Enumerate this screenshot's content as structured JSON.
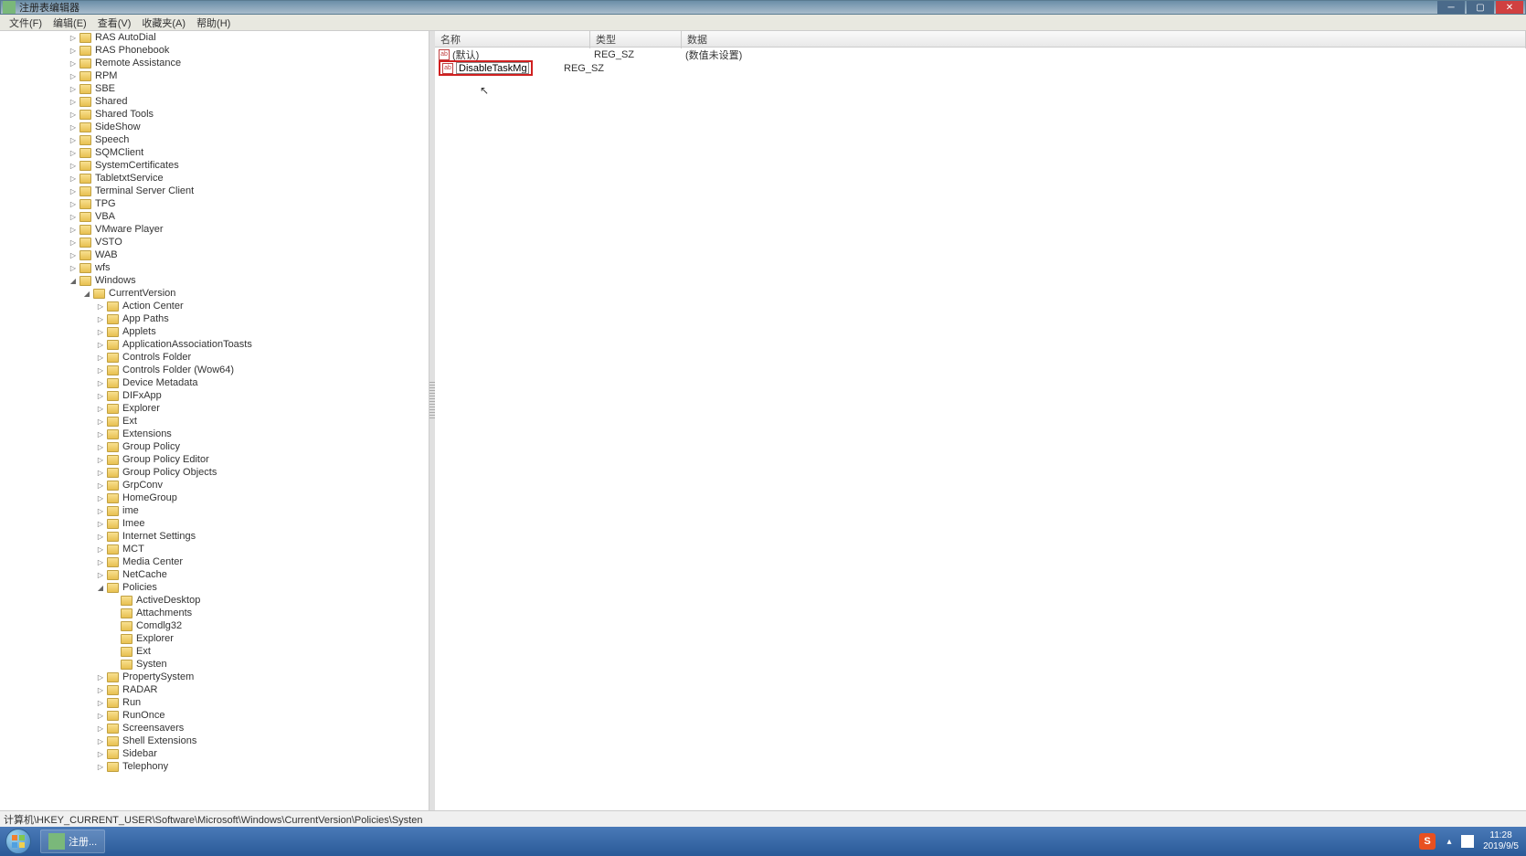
{
  "window": {
    "title": "注册表编辑器"
  },
  "menu": {
    "file": "文件(F)",
    "edit": "编辑(E)",
    "view": "查看(V)",
    "favorites": "收藏夹(A)",
    "help": "帮助(H)"
  },
  "tree": {
    "level1": [
      "RAS AutoDial",
      "RAS Phonebook",
      "Remote Assistance",
      "RPM",
      "SBE",
      "Shared",
      "Shared Tools",
      "SideShow",
      "Speech",
      "SQMClient",
      "SystemCertificates",
      "TabletxtService",
      "Terminal Server Client",
      "TPG",
      "VBA",
      "VMware Player",
      "VSTO",
      "WAB",
      "wfs"
    ],
    "windows": "Windows",
    "currentVersion": "CurrentVersion",
    "cv_children": [
      "Action Center",
      "App Paths",
      "Applets",
      "ApplicationAssociationToasts",
      "Controls Folder",
      "Controls Folder (Wow64)",
      "Device Metadata",
      "DIFxApp",
      "Explorer",
      "Ext",
      "Extensions",
      "Group Policy",
      "Group Policy Editor",
      "Group Policy Objects",
      "GrpConv",
      "HomeGroup",
      "ime",
      "Imee",
      "Internet Settings",
      "MCT",
      "Media Center",
      "NetCache"
    ],
    "policies": "Policies",
    "policies_children": [
      "ActiveDesktop",
      "Attachments",
      "Comdlg32",
      "Explorer",
      "Ext",
      "Systen"
    ],
    "after_policies": [
      "PropertySystem",
      "RADAR",
      "Run",
      "RunOnce",
      "Screensavers",
      "Shell Extensions",
      "Sidebar",
      "Telephony"
    ]
  },
  "list": {
    "headers": {
      "name": "名称",
      "type": "类型",
      "data": "数据"
    },
    "rows": [
      {
        "name": "(默认)",
        "type": "REG_SZ",
        "data": "(数值未设置)"
      }
    ],
    "editing": {
      "value": "DisableTaskMgr",
      "type": "REG_SZ",
      "data": ""
    }
  },
  "statusbar": {
    "path": "计算机\\HKEY_CURRENT_USER\\Software\\Microsoft\\Windows\\CurrentVersion\\Policies\\Systen"
  },
  "taskbar": {
    "task1": "注册...",
    "tray_ime": "S",
    "time": "11:28",
    "date": "2019/9/5"
  }
}
